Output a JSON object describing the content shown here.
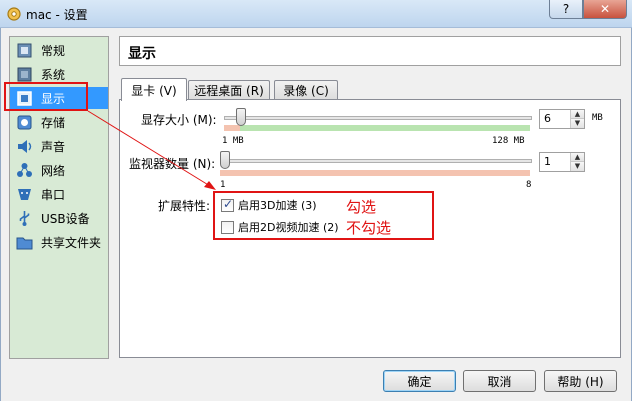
{
  "window": {
    "title": "mac - 设置"
  },
  "titlebar": {
    "help_label": "?",
    "close_label": "✕"
  },
  "nav": {
    "items": [
      {
        "label": "常规",
        "icon": "general-icon"
      },
      {
        "label": "系统",
        "icon": "system-icon"
      },
      {
        "label": "显示",
        "icon": "display-icon",
        "selected": true
      },
      {
        "label": "存储",
        "icon": "storage-icon"
      },
      {
        "label": "声音",
        "icon": "audio-icon"
      },
      {
        "label": "网络",
        "icon": "network-icon"
      },
      {
        "label": "串口",
        "icon": "serial-port-icon"
      },
      {
        "label": "USB设备",
        "icon": "usb-icon"
      },
      {
        "label": "共享文件夹",
        "icon": "shared-folder-icon"
      }
    ]
  },
  "main": {
    "title": "显示",
    "tabs": [
      {
        "label": "显卡 (V)",
        "active": true
      },
      {
        "label": "远程桌面 (R)",
        "active": false
      },
      {
        "label": "录像 (C)",
        "active": false
      }
    ],
    "video_memory": {
      "label": "显存大小 (M):",
      "value": "6",
      "unit": "MB",
      "min_label": "1  MB",
      "max_label": "128  MB",
      "slider_fraction": 0.04
    },
    "monitor_count": {
      "label": "监视器数量 (N):",
      "value": "1",
      "min_label": "1",
      "max_label": "8",
      "slider_fraction": 0.0
    },
    "extended_features": {
      "label": "扩展特性:",
      "enable_3d": {
        "label": "启用3D加速 (3)",
        "checked": true
      },
      "enable_2d": {
        "label": "启用2D视频加速 (2)",
        "checked": false
      }
    }
  },
  "annotation": {
    "check_note": "勾选",
    "uncheck_note": "不勾选"
  },
  "buttons": {
    "ok": "确定",
    "cancel": "取消",
    "help": "帮助 (H)"
  },
  "colors": {
    "selection": "#3399ff",
    "nav_bg": "#d8ead5",
    "annotation_red": "#e01414",
    "range_green": "#b9e4b0",
    "range_red": "#f4c3b0"
  }
}
